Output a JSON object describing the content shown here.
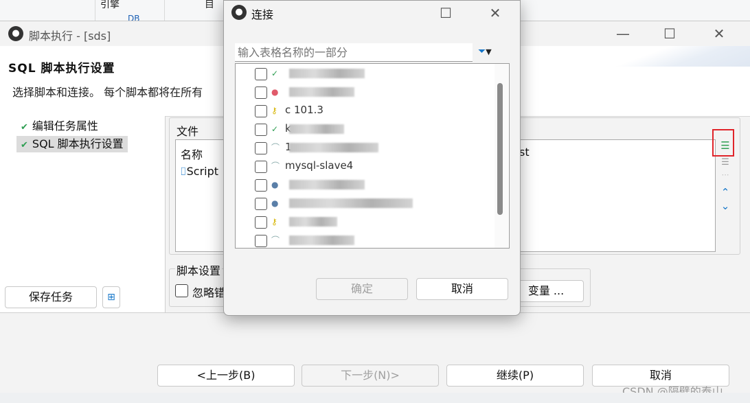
{
  "background": {
    "col1_text": "引擎",
    "col2_text": "目",
    "stray_text": "DB"
  },
  "main_window": {
    "title": "脚本执行 - [sds]",
    "header_title": "SQL 脚本执行设置",
    "header_desc": "选择脚本和连接。 每个脚本都将在所有",
    "nav": [
      {
        "label": "编辑任务属性",
        "selected": false
      },
      {
        "label": "SQL 脚本执行设置",
        "selected": true
      }
    ],
    "save_task_label": "保存任务",
    "files_group_label": "文件",
    "files_col_name": "名称",
    "files_col_right": "st",
    "file_item": "Script",
    "script_settings_label": "脚本设置",
    "ignore_errors_label": "忽略错",
    "variables_label": "变量 ...",
    "prev_label": "<上一步(B)",
    "next_label": "下一步(N)>",
    "continue_label": "继续(P)",
    "cancel_label": "取消",
    "watermark": "CSDN @隔壁的泰山"
  },
  "dialog": {
    "title": "连接",
    "search_placeholder": "输入表格名称的一部分",
    "connections": [
      {
        "name": "",
        "icon": "db-connected-icon"
      },
      {
        "name": "",
        "icon": "db-red-icon"
      },
      {
        "name": "c        101.3",
        "icon": "db-key-icon"
      },
      {
        "name": "k",
        "icon": "db-connected-icon"
      },
      {
        "name": "                  1",
        "icon": "db-plain-icon"
      },
      {
        "name": "mysql-slave4",
        "icon": "db-plain-icon"
      },
      {
        "name": "",
        "icon": "db-blue-icon"
      },
      {
        "name": "",
        "icon": "db-blue-icon"
      },
      {
        "name": "",
        "icon": "db-key-icon"
      },
      {
        "name": "",
        "icon": "db-plain-icon"
      }
    ],
    "ok_label": "确定",
    "cancel_label": "取消"
  },
  "colors": {
    "accent": "#1677c9",
    "highlight_red": "#e0242a",
    "check_green": "#2e9e52"
  }
}
